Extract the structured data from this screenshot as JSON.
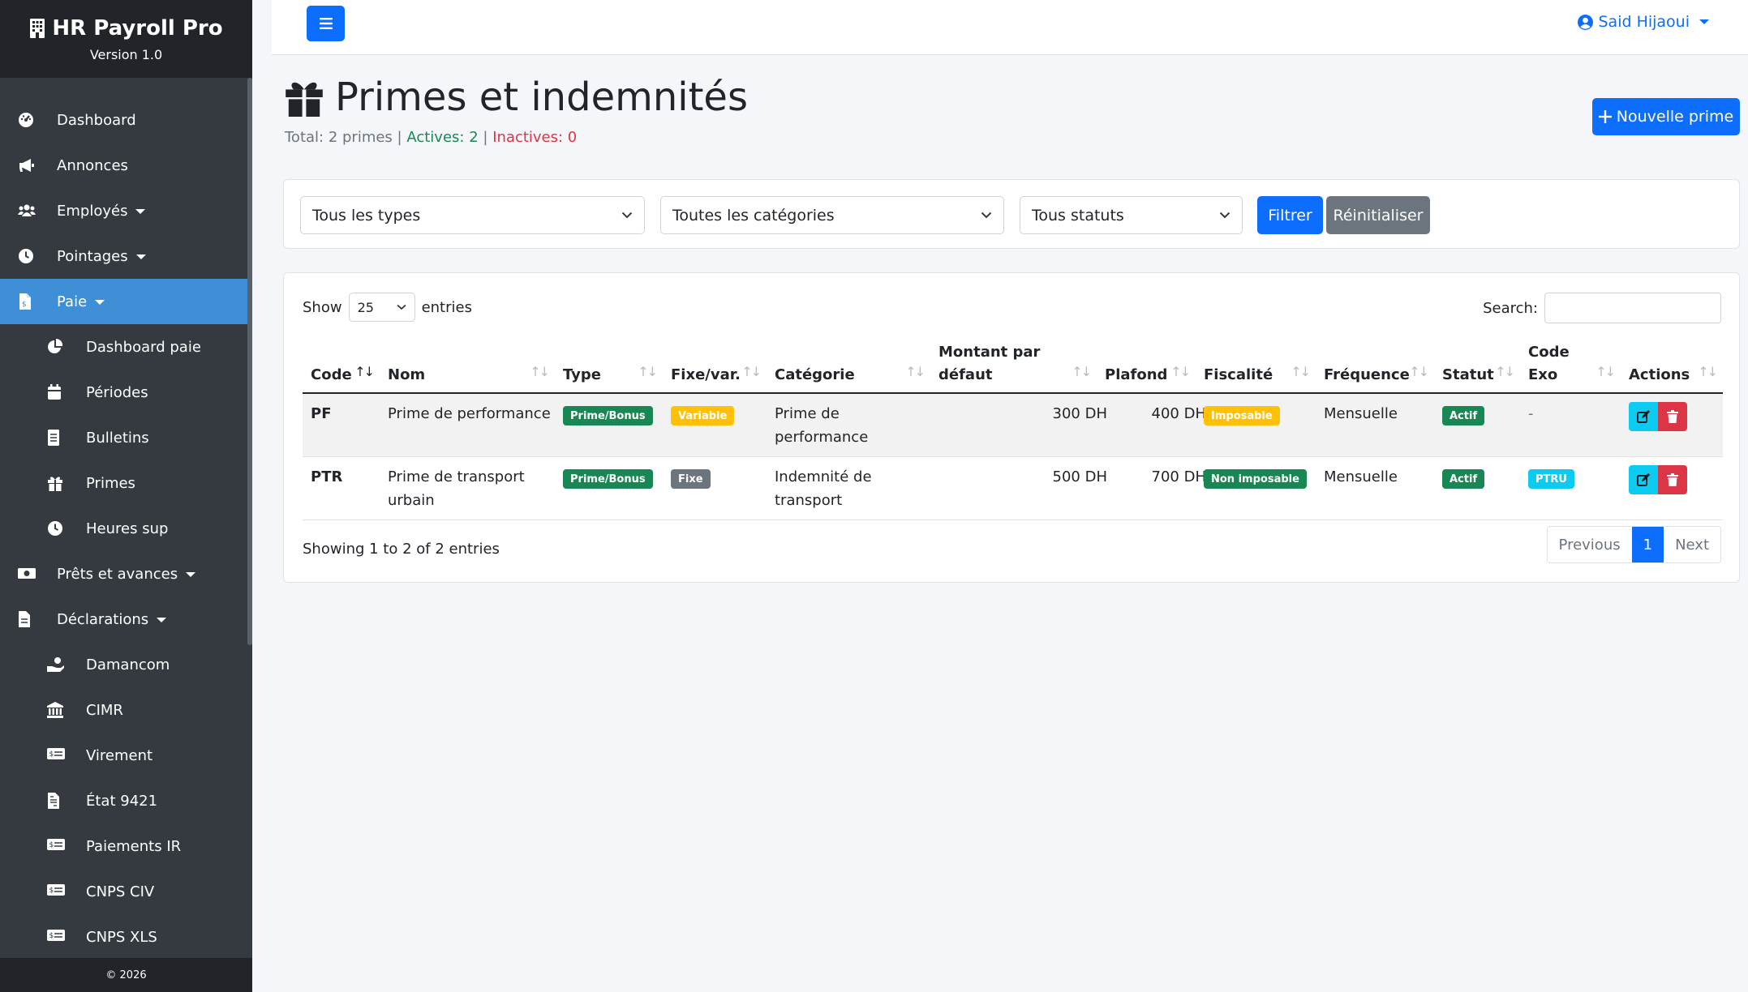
{
  "app": {
    "title": "HR Payroll Pro",
    "version": "Version 1.0",
    "copyright": "© 2026"
  },
  "colors": {
    "primary": "#0d6efd",
    "success": "#198754",
    "danger": "#dc3545",
    "warning": "#ffc107",
    "info": "#0dcaf0",
    "secondary": "#6c757d",
    "sidebar": "#343a40",
    "sidebar_active": "#3e8fd6"
  },
  "sidebar": {
    "items": [
      {
        "label": "Dashboard",
        "icon": "gauge-icon"
      },
      {
        "label": "Annonces",
        "icon": "bullhorn-icon"
      },
      {
        "label": "Employés",
        "icon": "users-icon"
      },
      {
        "label": "Pointages",
        "icon": "clock-icon"
      },
      {
        "label": "Paie",
        "icon": "invoice-icon",
        "active": true
      },
      {
        "label": "Dashboard paie",
        "icon": "pie-chart-icon"
      },
      {
        "label": "Périodes",
        "icon": "calendar-icon"
      },
      {
        "label": "Bulletins",
        "icon": "document-icon"
      },
      {
        "label": "Primes",
        "icon": "gift-icon"
      },
      {
        "label": "Heures sup",
        "icon": "clock-icon"
      },
      {
        "label": "Prêts et avances",
        "icon": "money-bill-icon"
      },
      {
        "label": "Déclarations",
        "icon": "file-icon"
      },
      {
        "label": "Damancom",
        "icon": "hand-holding-icon"
      },
      {
        "label": "CIMR",
        "icon": "bank-icon"
      },
      {
        "label": "Virement",
        "icon": "money-check-icon"
      },
      {
        "label": "État 9421",
        "icon": "file-invoice-icon"
      },
      {
        "label": "Paiements IR",
        "icon": "money-check-icon"
      },
      {
        "label": "CNPS CIV",
        "icon": "money-check-icon"
      },
      {
        "label": "CNPS XLS",
        "icon": "money-check-icon"
      }
    ]
  },
  "navbar": {
    "user_name": "Said Hijaoui"
  },
  "page": {
    "title": "Primes et indemnités",
    "stats": {
      "total": "Total: 2 primes",
      "sep": "|",
      "actives": "Actives: 2",
      "inactives": "Inactives: 0"
    },
    "new_button": "Nouvelle prime"
  },
  "filters": {
    "type": "Tous les types",
    "category": "Toutes les catégories",
    "status": "Tous statuts",
    "filter_button": "Filtrer",
    "reset_button": "Réinitialiser"
  },
  "table": {
    "show_label": "Show",
    "entries_value": "25",
    "entries_label": "entries",
    "search_label": "Search:",
    "headers": {
      "code": "Code",
      "nom": "Nom",
      "type": "Type",
      "fixe": "Fixe/var.",
      "categorie": "Catégorie",
      "montant_1": "Montant par",
      "montant_2": "défaut",
      "plafond": "Plafond",
      "fiscalite": "Fiscalité",
      "frequence": "Fréquence",
      "statut": "Statut",
      "codeexo_1": "Code",
      "codeexo_2": "Exo",
      "actions": "Actions"
    },
    "rows": [
      {
        "code": "PF",
        "nom_1": "Prime de performance",
        "nom_2": "",
        "type": "Prime/Bonus",
        "fixe": "Variable",
        "cat_1": "Prime de",
        "cat_2": "performance",
        "montant": "300 DH",
        "plafond": "400 DH",
        "fiscalite": "Imposable",
        "frequence": "Mensuelle",
        "statut": "Actif",
        "code_exo": "-"
      },
      {
        "code": "PTR",
        "nom_1": "Prime de transport",
        "nom_2": "urbain",
        "type": "Prime/Bonus",
        "fixe": "Fixe",
        "cat_1": "Indemnité de",
        "cat_2": "transport",
        "montant": "500 DH",
        "plafond": "700 DH",
        "fiscalite": "Non imposable",
        "frequence": "Mensuelle",
        "statut": "Actif",
        "code_exo": "PTRU"
      }
    ],
    "info": "Showing 1 to 2 of 2 entries",
    "pagination": {
      "previous": "Previous",
      "current": "1",
      "next": "Next"
    }
  }
}
